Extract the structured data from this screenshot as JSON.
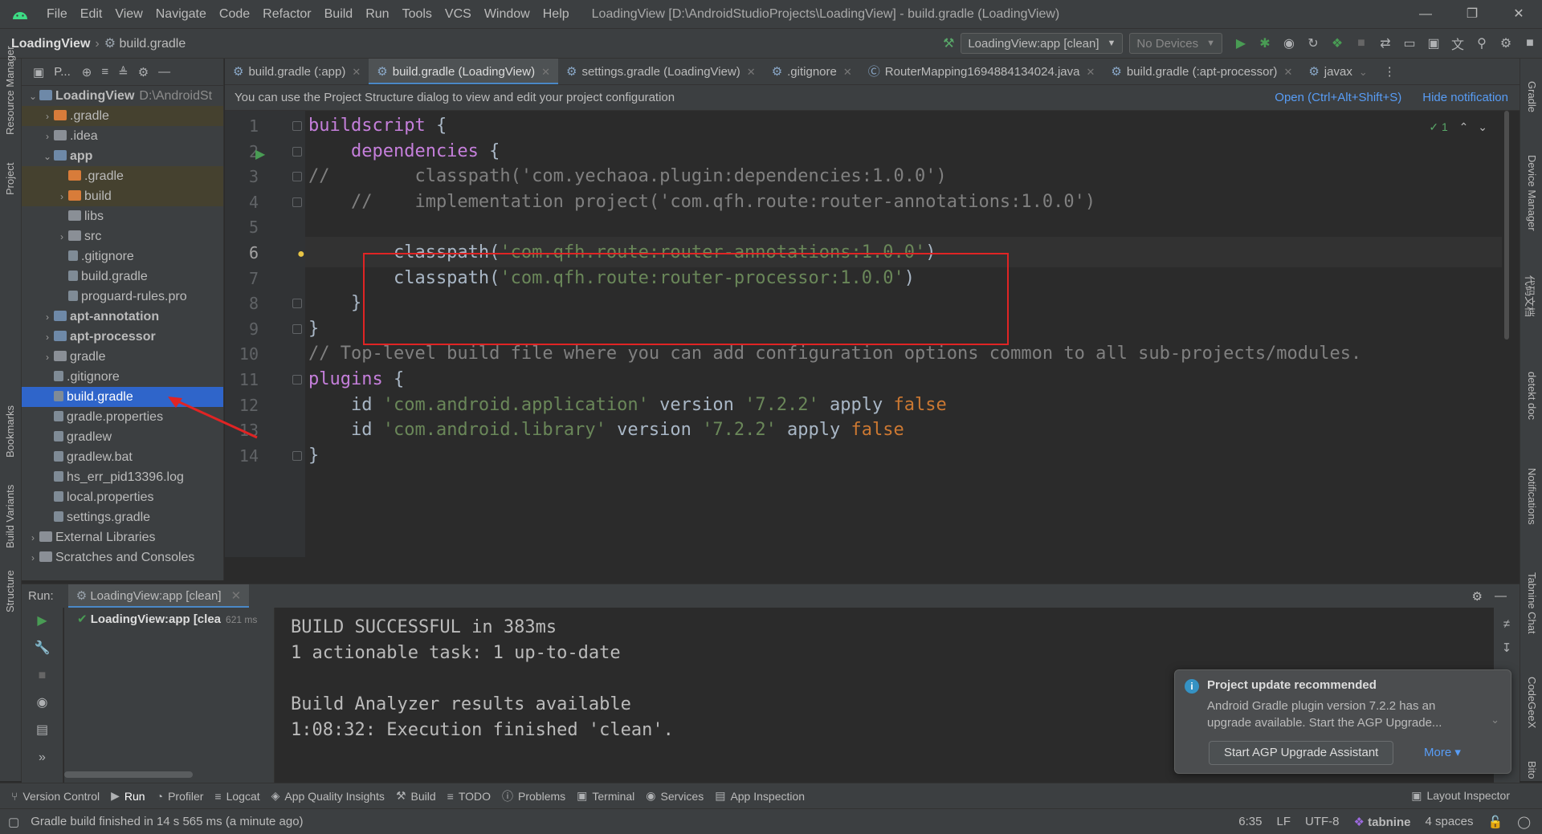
{
  "menubar": {
    "items": [
      "File",
      "Edit",
      "View",
      "Navigate",
      "Code",
      "Refactor",
      "Build",
      "Run",
      "Tools",
      "VCS",
      "Window",
      "Help"
    ],
    "window_title": "LoadingView [D:\\AndroidStudioProjects\\LoadingView] - build.gradle (LoadingView)"
  },
  "navbar": {
    "project": "LoadingView",
    "file": "build.gradle",
    "run_config": "LoadingView:app [clean]",
    "device": "No Devices"
  },
  "project_panel": {
    "title": "P...",
    "tree": [
      {
        "label": "LoadingView",
        "path": "D:\\AndroidSt",
        "indent": 0,
        "chev": "expanded",
        "icon": "folder-blue",
        "bold": true
      },
      {
        "label": ".gradle",
        "indent": 1,
        "chev": "collapsed",
        "icon": "folder-orange",
        "excluded": true
      },
      {
        "label": ".idea",
        "indent": 1,
        "chev": "collapsed",
        "icon": "folder-gray"
      },
      {
        "label": "app",
        "indent": 1,
        "chev": "expanded",
        "icon": "folder-blue",
        "bold": true
      },
      {
        "label": ".gradle",
        "indent": 2,
        "chev": "none",
        "icon": "folder-orange",
        "excluded": true
      },
      {
        "label": "build",
        "indent": 2,
        "chev": "collapsed",
        "icon": "folder-orange",
        "excluded": true
      },
      {
        "label": "libs",
        "indent": 2,
        "chev": "none",
        "icon": "folder-gray"
      },
      {
        "label": "src",
        "indent": 2,
        "chev": "collapsed",
        "icon": "folder-gray"
      },
      {
        "label": ".gitignore",
        "indent": 2,
        "chev": "none",
        "icon": "file"
      },
      {
        "label": "build.gradle",
        "indent": 2,
        "chev": "none",
        "icon": "file"
      },
      {
        "label": "proguard-rules.pro",
        "indent": 2,
        "chev": "none",
        "icon": "file"
      },
      {
        "label": "apt-annotation",
        "indent": 1,
        "chev": "collapsed",
        "icon": "folder-blue",
        "bold": true
      },
      {
        "label": "apt-processor",
        "indent": 1,
        "chev": "collapsed",
        "icon": "folder-blue",
        "bold": true
      },
      {
        "label": "gradle",
        "indent": 1,
        "chev": "collapsed",
        "icon": "folder-gray"
      },
      {
        "label": ".gitignore",
        "indent": 1,
        "chev": "none",
        "icon": "file"
      },
      {
        "label": "build.gradle",
        "indent": 1,
        "chev": "none",
        "icon": "file",
        "selected": true
      },
      {
        "label": "gradle.properties",
        "indent": 1,
        "chev": "none",
        "icon": "file"
      },
      {
        "label": "gradlew",
        "indent": 1,
        "chev": "none",
        "icon": "file"
      },
      {
        "label": "gradlew.bat",
        "indent": 1,
        "chev": "none",
        "icon": "file"
      },
      {
        "label": "hs_err_pid13396.log",
        "indent": 1,
        "chev": "none",
        "icon": "file"
      },
      {
        "label": "local.properties",
        "indent": 1,
        "chev": "none",
        "icon": "file"
      },
      {
        "label": "settings.gradle",
        "indent": 1,
        "chev": "none",
        "icon": "file"
      },
      {
        "label": "External Libraries",
        "indent": 0,
        "chev": "collapsed",
        "icon": "folder-gray"
      },
      {
        "label": "Scratches and Consoles",
        "indent": 0,
        "chev": "collapsed",
        "icon": "folder-gray"
      }
    ]
  },
  "editor_tabs": [
    {
      "label": "build.gradle (:app)",
      "active": false
    },
    {
      "label": "build.gradle (LoadingView)",
      "active": true
    },
    {
      "label": "settings.gradle (LoadingView)",
      "active": false
    },
    {
      "label": ".gitignore",
      "active": false
    },
    {
      "label": "RouterMapping1694884134024.java",
      "active": false
    },
    {
      "label": "build.gradle (:apt-processor)",
      "active": false
    },
    {
      "label": "javax",
      "active": false
    }
  ],
  "banner": {
    "message": "You can use the Project Structure dialog to view and edit your project configuration",
    "open_link": "Open (Ctrl+Alt+Shift+S)",
    "hide_link": "Hide notification"
  },
  "editor": {
    "inspection_count": "1",
    "lines": [
      [
        {
          "t": "buildscript",
          "c": "blk"
        },
        {
          "t": " {",
          "c": "fn"
        }
      ],
      [
        {
          "t": "    dependencies",
          "c": "blk"
        },
        {
          "t": " {",
          "c": "fn"
        }
      ],
      [
        {
          "t": "//        classpath('com.yechaoa.plugin:dependencies:1.0.0')",
          "c": "cm"
        }
      ],
      [
        {
          "t": "    //    implementation project('com.qfh.route:router-annotations:1.0.0')",
          "c": "cm"
        }
      ],
      [],
      [
        {
          "t": "        classpath(",
          "c": "fn"
        },
        {
          "t": "'com.qfh.route:router-annotations:1.0.0'",
          "c": "str"
        },
        {
          "t": ")",
          "c": "fn"
        }
      ],
      [
        {
          "t": "        classpath(",
          "c": "fn"
        },
        {
          "t": "'com.qfh.route:router-processor:1.0.0'",
          "c": "str"
        },
        {
          "t": ")",
          "c": "fn"
        }
      ],
      [
        {
          "t": "    }",
          "c": "fn"
        }
      ],
      [
        {
          "t": "}",
          "c": "fn"
        }
      ],
      [
        {
          "t": "// Top-level build file where you can add configuration options common to all sub-projects/modules.",
          "c": "cm"
        }
      ],
      [
        {
          "t": "plugins",
          "c": "blk"
        },
        {
          "t": " {",
          "c": "fn"
        }
      ],
      [
        {
          "t": "    id ",
          "c": "fn"
        },
        {
          "t": "'com.android.application'",
          "c": "str"
        },
        {
          "t": " version ",
          "c": "fn"
        },
        {
          "t": "'7.2.2'",
          "c": "str"
        },
        {
          "t": " apply ",
          "c": "fn"
        },
        {
          "t": "false",
          "c": "kw"
        }
      ],
      [
        {
          "t": "    id ",
          "c": "fn"
        },
        {
          "t": "'com.android.library'",
          "c": "str"
        },
        {
          "t": " version ",
          "c": "fn"
        },
        {
          "t": "'7.2.2'",
          "c": "str"
        },
        {
          "t": " apply ",
          "c": "fn"
        },
        {
          "t": "false",
          "c": "kw"
        }
      ],
      [
        {
          "t": "}",
          "c": "fn"
        }
      ]
    ],
    "current_line": 6
  },
  "run_panel": {
    "label": "Run:",
    "tab": "LoadingView:app [clean]",
    "tree_item": "LoadingView:app [clea",
    "tree_duration": "621 ms",
    "console": [
      "BUILD SUCCESSFUL in 383ms",
      "1 actionable task: 1 up-to-date",
      "",
      "Build Analyzer results available",
      "1:08:32: Execution finished 'clean'."
    ]
  },
  "popup": {
    "title": "Project update recommended",
    "body": "Android Gradle plugin version 7.2.2 has an upgrade available. Start the AGP Upgrade...",
    "button": "Start AGP Upgrade Assistant",
    "more": "More"
  },
  "bottom_tools": [
    {
      "label": "Version Control",
      "icon": "branch-icon"
    },
    {
      "label": "Run",
      "icon": "play-icon",
      "active": true
    },
    {
      "label": "Profiler",
      "icon": "gauge-icon"
    },
    {
      "label": "Logcat",
      "icon": "list-icon"
    },
    {
      "label": "App Quality Insights",
      "icon": "shield-icon"
    },
    {
      "label": "Build",
      "icon": "hammer-icon"
    },
    {
      "label": "TODO",
      "icon": "list-icon"
    },
    {
      "label": "Problems",
      "icon": "info-icon"
    },
    {
      "label": "Terminal",
      "icon": "terminal-icon"
    },
    {
      "label": "Services",
      "icon": "services-icon"
    },
    {
      "label": "App Inspection",
      "icon": "inspect-icon"
    }
  ],
  "layout_inspector": "Layout Inspector",
  "statusbar": {
    "message": "Gradle build finished in 14 s 565 ms (a minute ago)",
    "position": "6:35",
    "line_sep": "LF",
    "encoding": "UTF-8",
    "tabnine": "tabnine",
    "indent": "4 spaces"
  },
  "left_stripe": [
    "Resource Manager",
    "Project",
    "Bookmarks",
    "Build Variants",
    "Structure"
  ],
  "right_stripe": [
    "Gradle",
    "Device Manager",
    "代码文档",
    "detekt doc",
    "Notifications",
    "Tabnine Chat",
    "CodeGeeX",
    "Bito"
  ]
}
